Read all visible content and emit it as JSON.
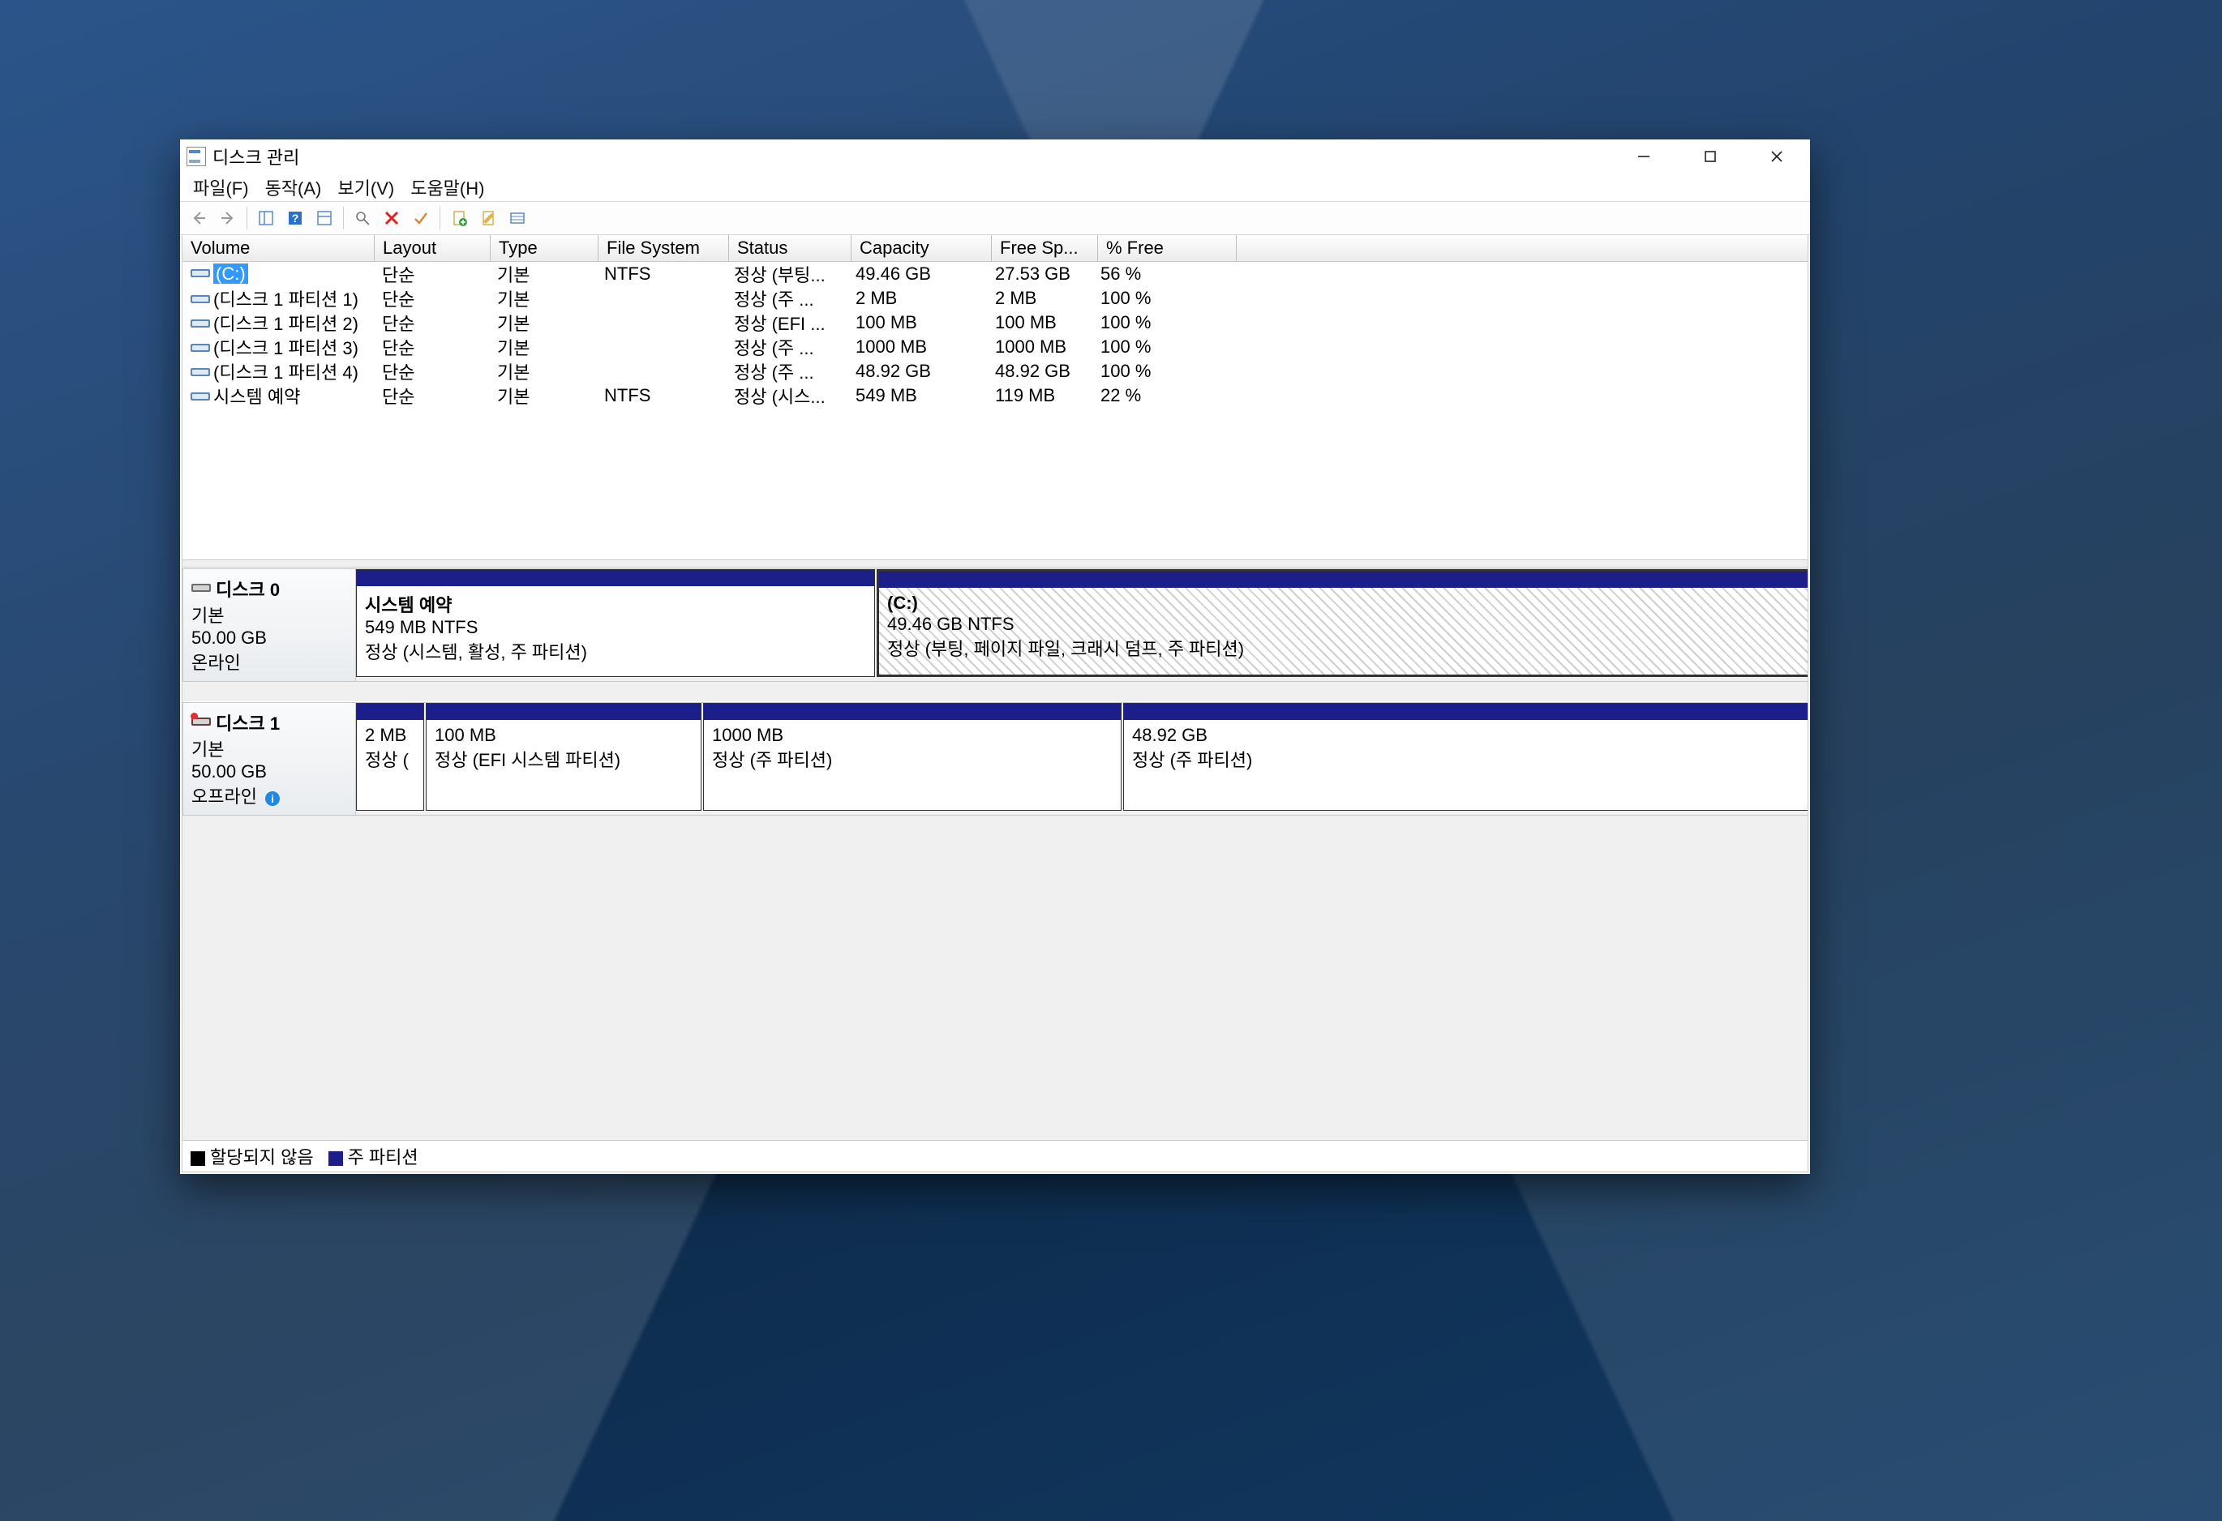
{
  "window": {
    "title": "디스크 관리"
  },
  "menus": [
    "파일(F)",
    "동작(A)",
    "보기(V)",
    "도움말(H)"
  ],
  "columns": [
    "Volume",
    "Layout",
    "Type",
    "File System",
    "Status",
    "Capacity",
    "Free Sp...",
    "% Free"
  ],
  "volumes": [
    {
      "name": "(C:)",
      "layout": "단순",
      "type": "기본",
      "fs": "NTFS",
      "status": "정상 (부팅...",
      "capacity": "49.46 GB",
      "free": "27.53 GB",
      "pct": "56 %",
      "selected": true
    },
    {
      "name": "(디스크 1 파티션 1)",
      "layout": "단순",
      "type": "기본",
      "fs": "",
      "status": "정상 (주 ...",
      "capacity": "2 MB",
      "free": "2 MB",
      "pct": "100 %"
    },
    {
      "name": "(디스크 1 파티션 2)",
      "layout": "단순",
      "type": "기본",
      "fs": "",
      "status": "정상 (EFI ...",
      "capacity": "100 MB",
      "free": "100 MB",
      "pct": "100 %"
    },
    {
      "name": "(디스크 1 파티션 3)",
      "layout": "단순",
      "type": "기본",
      "fs": "",
      "status": "정상 (주 ...",
      "capacity": "1000 MB",
      "free": "1000 MB",
      "pct": "100 %"
    },
    {
      "name": "(디스크 1 파티션 4)",
      "layout": "단순",
      "type": "기본",
      "fs": "",
      "status": "정상 (주 ...",
      "capacity": "48.92 GB",
      "free": "48.92 GB",
      "pct": "100 %"
    },
    {
      "name": "시스템 예약",
      "layout": "단순",
      "type": "기본",
      "fs": "NTFS",
      "status": "정상 (시스...",
      "capacity": "549 MB",
      "free": "119 MB",
      "pct": "22 %"
    }
  ],
  "disks": [
    {
      "title": "디스크 0",
      "type": "기본",
      "size": "50.00 GB",
      "state": "온라인",
      "offline": false,
      "partitions": [
        {
          "title": "시스템 예약",
          "size_fs": "549 MB NTFS",
          "status": "정상 (시스템, 활성, 주 파티션)",
          "widthPx": 638,
          "selected": false
        },
        {
          "title": "(C:)",
          "size_fs": "49.46 GB NTFS",
          "status": "정상 (부팅, 페이지 파일, 크래시 덤프, 주 파티션)",
          "widthPx": 1158,
          "selected": true
        }
      ]
    },
    {
      "title": "디스크 1",
      "type": "기본",
      "size": "50.00 GB",
      "state": "오프라인",
      "offline": true,
      "partitions": [
        {
          "title": "",
          "size_fs": "2 MB",
          "status": "정상 (",
          "widthPx": 82
        },
        {
          "title": "",
          "size_fs": "100 MB",
          "status": "정상 (EFI 시스템 파티션)",
          "widthPx": 338
        },
        {
          "title": "",
          "size_fs": "1000 MB",
          "status": "정상 (주 파티션)",
          "widthPx": 514
        },
        {
          "title": "",
          "size_fs": "48.92 GB",
          "status": "정상 (주 파티션)",
          "widthPx": 860
        }
      ]
    }
  ],
  "legend": {
    "unalloc": "할당되지 않음",
    "primary": "주 파티션"
  }
}
